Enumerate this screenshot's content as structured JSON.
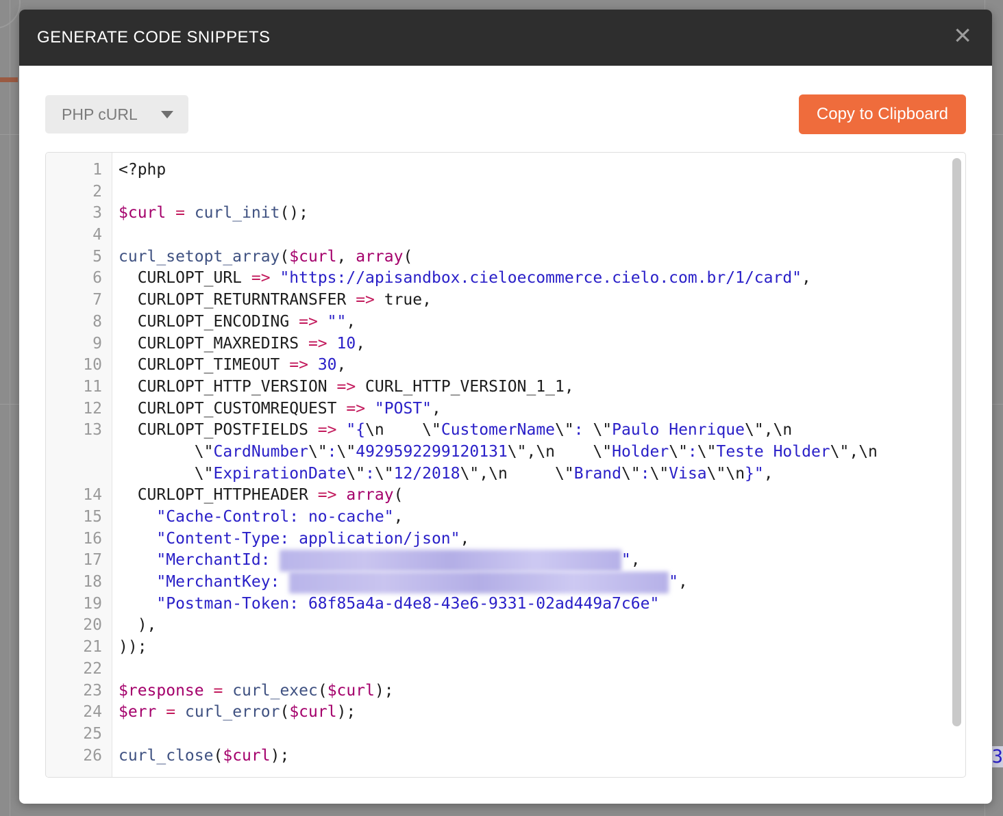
{
  "modal": {
    "title": "GENERATE CODE SNIPPETS",
    "close_icon": "close-icon",
    "close_glyph": "×"
  },
  "toolbar": {
    "language_label": "PHP cURL",
    "language_options": [
      "PHP cURL"
    ],
    "caret_icon": "chevron-down-icon",
    "copy_label": "Copy to Clipboard",
    "accent_color": "#ef6c3c",
    "header_color": "#2e2e2e"
  },
  "background": {
    "partial_digit": "3"
  },
  "code": {
    "language": "php",
    "line_numbers": [
      1,
      2,
      3,
      4,
      5,
      6,
      7,
      8,
      9,
      10,
      11,
      12,
      13,
      14,
      15,
      16,
      17,
      18,
      19,
      20,
      21,
      22,
      23,
      24,
      25,
      26
    ],
    "visible_line_count": 26,
    "plain_text": "<?php\n\n$curl = curl_init();\n\ncurl_setopt_array($curl, array(\n  CURLOPT_URL => \"https://apisandbox.cieloecommerce.cielo.com.br/1/card\",\n  CURLOPT_RETURNTRANSFER => true,\n  CURLOPT_ENCODING => \"\",\n  CURLOPT_MAXREDIRS => 10,\n  CURLOPT_TIMEOUT => 30,\n  CURLOPT_HTTP_VERSION => CURL_HTTP_VERSION_1_1,\n  CURLOPT_CUSTOMREQUEST => \"POST\",\n  CURLOPT_POSTFIELDS => \"{\\n    \\\"CustomerName\\\": \\\"Paulo Henrique\\\",\\n    \\\"CardNumber\\\":\\\"4929592299120131\\\",\\n    \\\"Holder\\\":\\\"Teste Holder\\\",\\n    \\\"ExpirationDate\\\":\\\"12/2018\\\",\\n    \\\"Brand\\\":\\\"Visa\\\"\\n}\",\n  CURLOPT_HTTPHEADER => array(\n    \"Cache-Control: no-cache\",\n    \"Content-Type: application/json\",\n    \"MerchantId: [REDACTED]\",\n    \"MerchantKey: [REDACTED]\",\n    \"Postman-Token: 68f85a4a-d4e8-43e6-9331-02ad449a7c6e\"\n  ),\n));\n\n$response = curl_exec($curl);\n$err = curl_error($curl);\n\ncurl_close($curl);",
    "rows": [
      {
        "n": 1,
        "tokens": [
          {
            "t": "plain",
            "v": "<?php"
          }
        ]
      },
      {
        "n": 2,
        "tokens": []
      },
      {
        "n": 3,
        "tokens": [
          {
            "t": "var",
            "v": "$curl"
          },
          {
            "t": "plain",
            "v": " "
          },
          {
            "t": "op",
            "v": "="
          },
          {
            "t": "plain",
            "v": " "
          },
          {
            "t": "fn",
            "v": "curl_init"
          },
          {
            "t": "plain",
            "v": "();"
          }
        ]
      },
      {
        "n": 4,
        "tokens": []
      },
      {
        "n": 5,
        "tokens": [
          {
            "t": "fn",
            "v": "curl_setopt_array"
          },
          {
            "t": "plain",
            "v": "("
          },
          {
            "t": "var",
            "v": "$curl"
          },
          {
            "t": "plain",
            "v": ", "
          },
          {
            "t": "kw",
            "v": "array"
          },
          {
            "t": "plain",
            "v": "("
          }
        ]
      },
      {
        "n": 6,
        "tokens": [
          {
            "t": "plain",
            "v": "  CURLOPT_URL "
          },
          {
            "t": "op",
            "v": "=>"
          },
          {
            "t": "plain",
            "v": " "
          },
          {
            "t": "str",
            "v": "\"https://apisandbox.cieloecommerce.cielo.com.br/1/card\""
          },
          {
            "t": "plain",
            "v": ","
          }
        ]
      },
      {
        "n": 7,
        "tokens": [
          {
            "t": "plain",
            "v": "  CURLOPT_RETURNTRANSFER "
          },
          {
            "t": "op",
            "v": "=>"
          },
          {
            "t": "plain",
            "v": " true,"
          }
        ]
      },
      {
        "n": 8,
        "tokens": [
          {
            "t": "plain",
            "v": "  CURLOPT_ENCODING "
          },
          {
            "t": "op",
            "v": "=>"
          },
          {
            "t": "plain",
            "v": " "
          },
          {
            "t": "str",
            "v": "\"\""
          },
          {
            "t": "plain",
            "v": ","
          }
        ]
      },
      {
        "n": 9,
        "tokens": [
          {
            "t": "plain",
            "v": "  CURLOPT_MAXREDIRS "
          },
          {
            "t": "op",
            "v": "=>"
          },
          {
            "t": "plain",
            "v": " "
          },
          {
            "t": "num",
            "v": "10"
          },
          {
            "t": "plain",
            "v": ","
          }
        ]
      },
      {
        "n": 10,
        "tokens": [
          {
            "t": "plain",
            "v": "  CURLOPT_TIMEOUT "
          },
          {
            "t": "op",
            "v": "=>"
          },
          {
            "t": "plain",
            "v": " "
          },
          {
            "t": "num",
            "v": "30"
          },
          {
            "t": "plain",
            "v": ","
          }
        ]
      },
      {
        "n": 11,
        "tokens": [
          {
            "t": "plain",
            "v": "  CURLOPT_HTTP_VERSION "
          },
          {
            "t": "op",
            "v": "=>"
          },
          {
            "t": "plain",
            "v": " CURL_HTTP_VERSION_1_1,"
          }
        ]
      },
      {
        "n": 12,
        "tokens": [
          {
            "t": "plain",
            "v": "  CURLOPT_CUSTOMREQUEST "
          },
          {
            "t": "op",
            "v": "=>"
          },
          {
            "t": "plain",
            "v": " "
          },
          {
            "t": "str",
            "v": "\"POST\""
          },
          {
            "t": "plain",
            "v": ","
          }
        ]
      },
      {
        "n": 13,
        "tokens": [
          {
            "t": "plain",
            "v": "  CURLOPT_POSTFIELDS "
          },
          {
            "t": "op",
            "v": "=>"
          },
          {
            "t": "plain",
            "v": " "
          },
          {
            "t": "str",
            "v": "\"{"
          },
          {
            "t": "plain",
            "v": "\\n"
          },
          {
            "t": "str",
            "v": "    "
          },
          {
            "t": "plain",
            "v": "\\\""
          },
          {
            "t": "str",
            "v": "CustomerName"
          },
          {
            "t": "plain",
            "v": "\\\""
          },
          {
            "t": "str",
            "v": ": "
          },
          {
            "t": "plain",
            "v": "\\\""
          },
          {
            "t": "str",
            "v": "Paulo Henrique"
          },
          {
            "t": "plain",
            "v": "\\\",\\n"
          }
        ]
      },
      {
        "n": null,
        "cont": true,
        "tokens": [
          {
            "t": "plain",
            "v": "        \\\""
          },
          {
            "t": "str",
            "v": "CardNumber"
          },
          {
            "t": "plain",
            "v": "\\\""
          },
          {
            "t": "str",
            "v": ":"
          },
          {
            "t": "plain",
            "v": "\\\""
          },
          {
            "t": "str",
            "v": "4929592299120131"
          },
          {
            "t": "plain",
            "v": "\\\",\\n    "
          },
          {
            "t": "plain",
            "v": "\\\""
          },
          {
            "t": "str",
            "v": "Holder"
          },
          {
            "t": "plain",
            "v": "\\\""
          },
          {
            "t": "str",
            "v": ":"
          },
          {
            "t": "plain",
            "v": "\\\""
          },
          {
            "t": "str",
            "v": "Teste Holder"
          },
          {
            "t": "plain",
            "v": "\\\",\\n"
          }
        ]
      },
      {
        "n": null,
        "cont": true,
        "tokens": [
          {
            "t": "plain",
            "v": "        \\\""
          },
          {
            "t": "str",
            "v": "ExpirationDate"
          },
          {
            "t": "plain",
            "v": "\\\""
          },
          {
            "t": "str",
            "v": ":"
          },
          {
            "t": "plain",
            "v": "\\\""
          },
          {
            "t": "str",
            "v": "12/2018"
          },
          {
            "t": "plain",
            "v": "\\\",\\n     "
          },
          {
            "t": "plain",
            "v": "\\\""
          },
          {
            "t": "str",
            "v": "Brand"
          },
          {
            "t": "plain",
            "v": "\\\""
          },
          {
            "t": "str",
            "v": ":"
          },
          {
            "t": "plain",
            "v": "\\\""
          },
          {
            "t": "str",
            "v": "Visa"
          },
          {
            "t": "plain",
            "v": "\\\"\\n"
          },
          {
            "t": "str",
            "v": "}\""
          },
          {
            "t": "plain",
            "v": ","
          }
        ]
      },
      {
        "n": 14,
        "tokens": [
          {
            "t": "plain",
            "v": "  CURLOPT_HTTPHEADER "
          },
          {
            "t": "op",
            "v": "=>"
          },
          {
            "t": "plain",
            "v": " "
          },
          {
            "t": "kw",
            "v": "array"
          },
          {
            "t": "plain",
            "v": "("
          }
        ]
      },
      {
        "n": 15,
        "tokens": [
          {
            "t": "plain",
            "v": "    "
          },
          {
            "t": "str",
            "v": "\"Cache-Control: no-cache\""
          },
          {
            "t": "plain",
            "v": ","
          }
        ]
      },
      {
        "n": 16,
        "tokens": [
          {
            "t": "plain",
            "v": "    "
          },
          {
            "t": "str",
            "v": "\"Content-Type: application/json\""
          },
          {
            "t": "plain",
            "v": ","
          }
        ]
      },
      {
        "n": 17,
        "tokens": [
          {
            "t": "plain",
            "v": "    "
          },
          {
            "t": "str",
            "v": "\"MerchantId: "
          },
          {
            "t": "redact",
            "v": "xxxxxxxx-xxxx-xxxx-xxxx-xxxxxxxxxxxx"
          },
          {
            "t": "str",
            "v": "\""
          },
          {
            "t": "plain",
            "v": ","
          }
        ]
      },
      {
        "n": 18,
        "tokens": [
          {
            "t": "plain",
            "v": "    "
          },
          {
            "t": "str",
            "v": "\"MerchantKey: "
          },
          {
            "t": "redact",
            "v": "xxxxxxxxxxxxxxxxxxxxxxxxxxxxxxxxxxxxxxxx"
          },
          {
            "t": "str",
            "v": "\""
          },
          {
            "t": "plain",
            "v": ","
          }
        ]
      },
      {
        "n": 19,
        "tokens": [
          {
            "t": "plain",
            "v": "    "
          },
          {
            "t": "str",
            "v": "\"Postman-Token: 68f85a4a-d4e8-43e6-9331-02ad449a7c6e\""
          }
        ]
      },
      {
        "n": 20,
        "tokens": [
          {
            "t": "plain",
            "v": "  ),"
          }
        ]
      },
      {
        "n": 21,
        "tokens": [
          {
            "t": "plain",
            "v": "));"
          }
        ]
      },
      {
        "n": 22,
        "tokens": []
      },
      {
        "n": 23,
        "tokens": [
          {
            "t": "var",
            "v": "$response"
          },
          {
            "t": "plain",
            "v": " "
          },
          {
            "t": "op",
            "v": "="
          },
          {
            "t": "plain",
            "v": " "
          },
          {
            "t": "fn",
            "v": "curl_exec"
          },
          {
            "t": "plain",
            "v": "("
          },
          {
            "t": "var",
            "v": "$curl"
          },
          {
            "t": "plain",
            "v": ");"
          }
        ]
      },
      {
        "n": 24,
        "tokens": [
          {
            "t": "var",
            "v": "$err"
          },
          {
            "t": "plain",
            "v": " "
          },
          {
            "t": "op",
            "v": "="
          },
          {
            "t": "plain",
            "v": " "
          },
          {
            "t": "fn",
            "v": "curl_error"
          },
          {
            "t": "plain",
            "v": "("
          },
          {
            "t": "var",
            "v": "$curl"
          },
          {
            "t": "plain",
            "v": ");"
          }
        ]
      },
      {
        "n": 25,
        "tokens": []
      },
      {
        "n": 26,
        "tokens": [
          {
            "t": "fn",
            "v": "curl_close"
          },
          {
            "t": "plain",
            "v": "("
          },
          {
            "t": "var",
            "v": "$curl"
          },
          {
            "t": "plain",
            "v": ");"
          }
        ]
      }
    ]
  }
}
